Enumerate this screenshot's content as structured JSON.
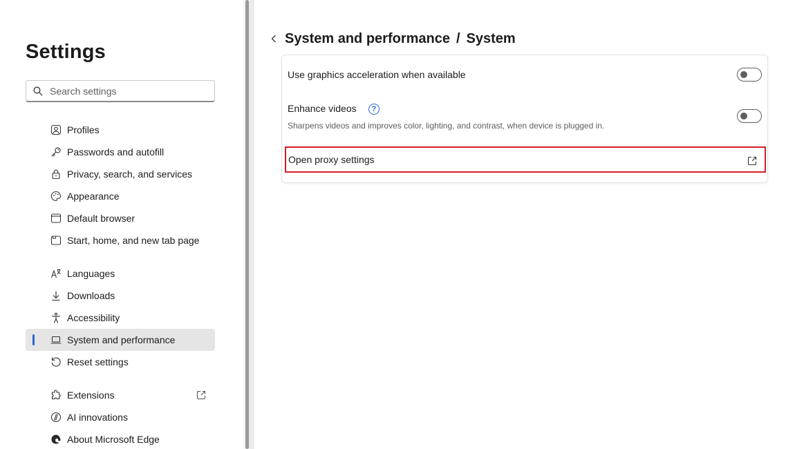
{
  "sidebar": {
    "title": "Settings",
    "search_placeholder": "Search settings",
    "items": [
      {
        "label": "Profiles"
      },
      {
        "label": "Passwords and autofill"
      },
      {
        "label": "Privacy, search, and services"
      },
      {
        "label": "Appearance"
      },
      {
        "label": "Default browser"
      },
      {
        "label": "Start, home, and new tab page"
      },
      {
        "label": "Languages"
      },
      {
        "label": "Downloads"
      },
      {
        "label": "Accessibility"
      },
      {
        "label": "System and performance",
        "active": true
      },
      {
        "label": "Reset settings"
      },
      {
        "label": "Extensions"
      },
      {
        "label": "AI innovations"
      },
      {
        "label": "About Microsoft Edge"
      }
    ]
  },
  "header": {
    "parent": "System and performance",
    "separator": "/",
    "current": "System"
  },
  "system_card": {
    "graphics": {
      "title": "Use graphics acceleration when available",
      "enabled": false
    },
    "enhance_videos": {
      "title": "Enhance videos",
      "help_glyph": "?",
      "subtitle": "Sharpens videos and improves color, lighting, and contrast, when device is plugged in.",
      "enabled": false
    },
    "proxy": {
      "title": "Open proxy settings"
    }
  },
  "colors": {
    "accent": "#2b64d4",
    "highlight_border": "#d21f26",
    "active_bg": "#e5e5e5"
  }
}
